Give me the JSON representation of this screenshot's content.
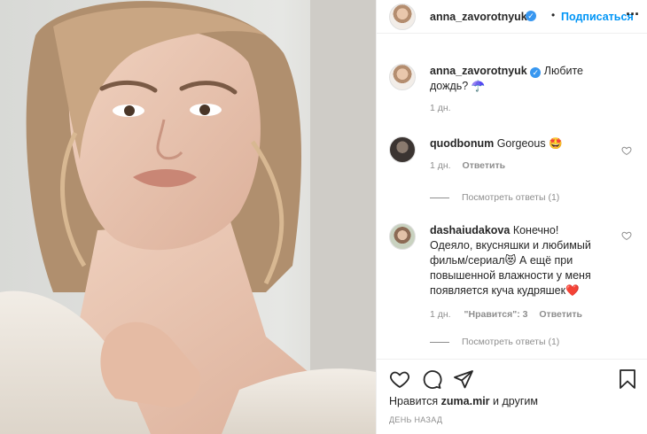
{
  "post": {
    "author": "anna_zavorotnyuk",
    "follow_label": "Подписаться",
    "dot": "•",
    "more_label": "···",
    "caption": "Любите дождь? ☂️",
    "caption_time": "1 дн."
  },
  "comments": [
    {
      "username": "quodbonum",
      "text": "Gorgeous 🤩",
      "time": "1 дн.",
      "reply_label": "Ответить",
      "view_replies": "Посмотреть ответы (1)"
    },
    {
      "username": "dashaiudakova",
      "text_lines": [
        "Конечно!",
        "Одеяло, вкусняшки и любимый",
        "фильм/сериал😻 А ещё при",
        "повышенной влажности у меня",
        "появляется куча кудряшек❤️"
      ],
      "time": "1 дн.",
      "likes_label": "\"Нравится\": 3",
      "reply_label": "Ответить",
      "view_replies": "Посмотреть ответы (1)"
    }
  ],
  "likes": {
    "prefix": "Нравится",
    "user": "zuma.mir",
    "suffix": "и другим"
  },
  "date_label": "ДЕНЬ НАЗАД",
  "icons": {
    "heart": "heart-icon",
    "comment": "comment-icon",
    "share": "share-icon",
    "save": "bookmark-icon",
    "verified": "verified-badge-icon",
    "more": "more-options-icon"
  },
  "colors": {
    "accent": "#0095f6",
    "verified": "#3897f0",
    "muted": "#8e8e8e",
    "text": "#262626"
  }
}
